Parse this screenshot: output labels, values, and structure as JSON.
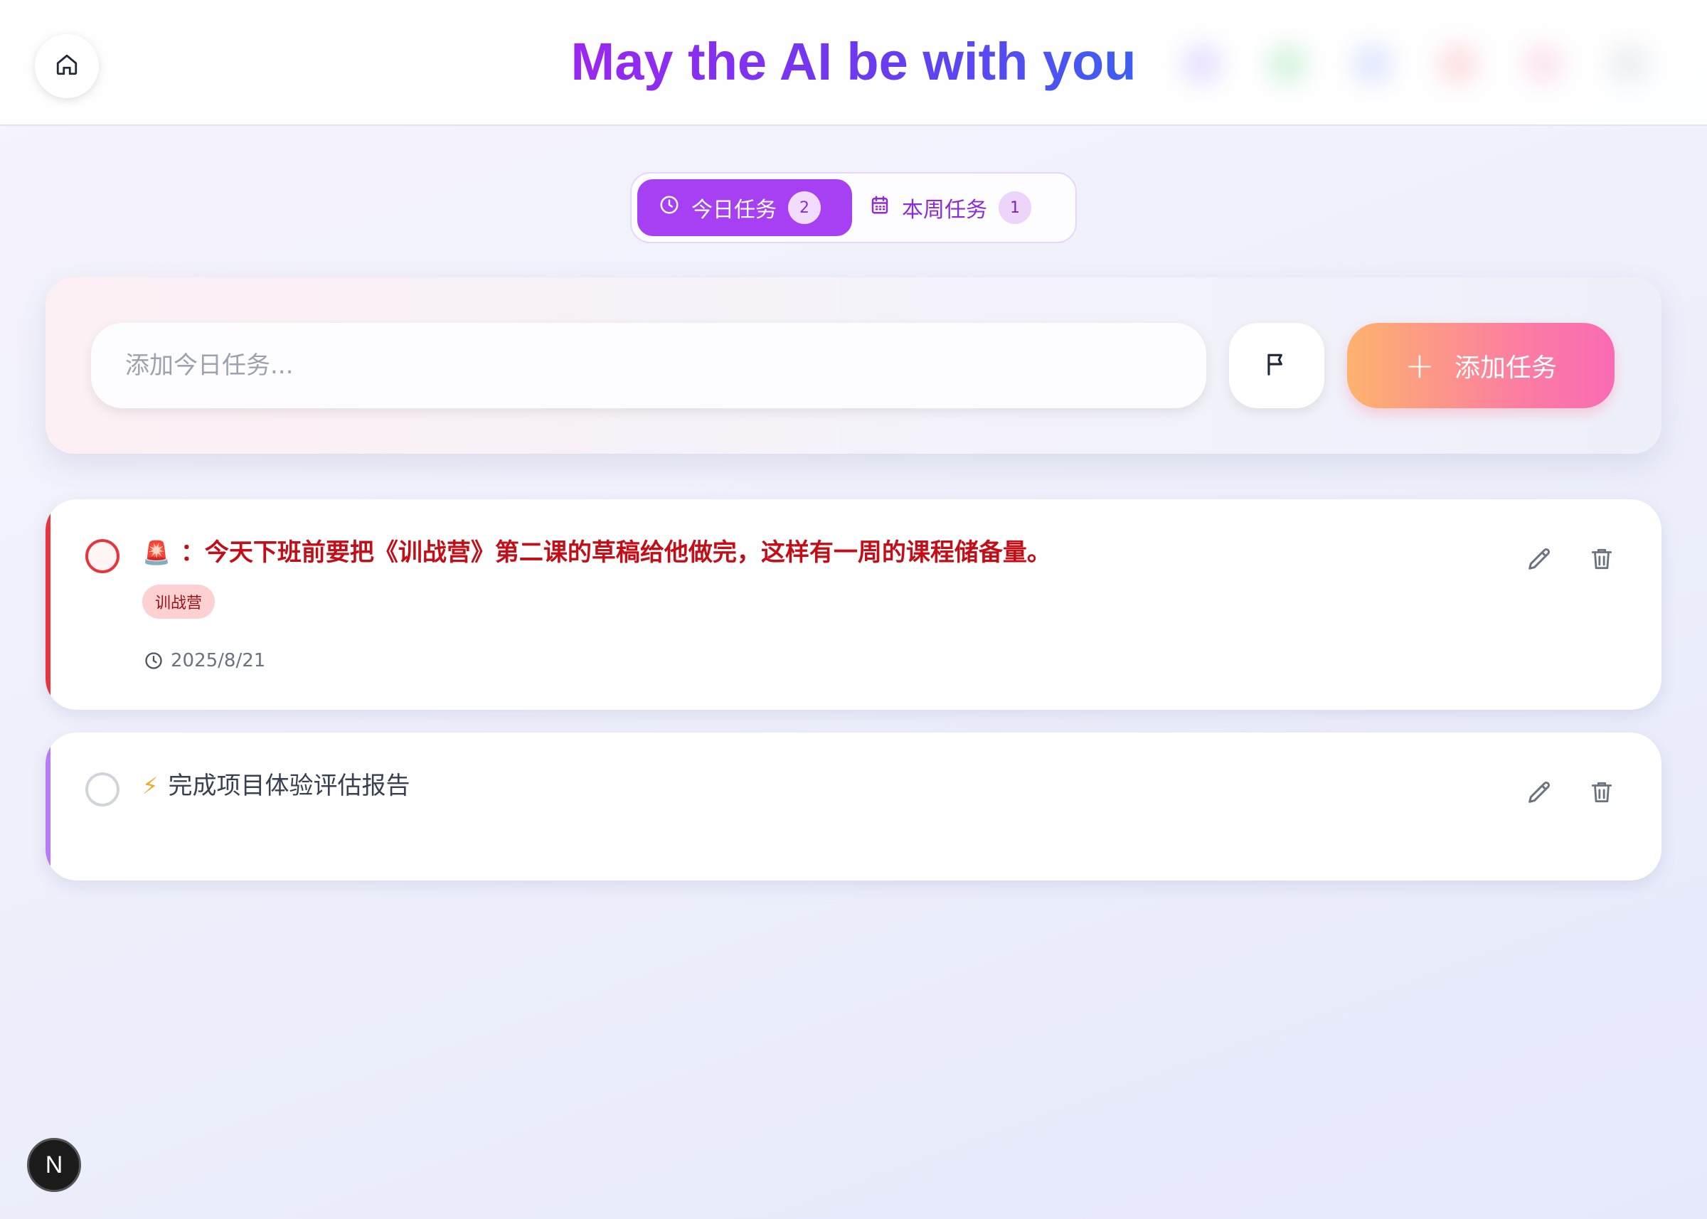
{
  "header": {
    "title": "May the AI be with you",
    "home_icon": "home-icon"
  },
  "tabs": [
    {
      "label": "今日任务",
      "count": "2",
      "icon": "clock-icon",
      "active": true
    },
    {
      "label": "本周任务",
      "count": "1",
      "icon": "calendar-icon",
      "active": false
    }
  ],
  "add_form": {
    "placeholder": "添加今日任务...",
    "value": "",
    "flag_icon": "flag-icon",
    "add_label": "添加任务"
  },
  "tasks": [
    {
      "emoji": "🚨",
      "text": "：今天下班前要把《训战营》第二课的草稿给他做完，这样有一周的课程储备量。",
      "tag": "训战营",
      "date": "2025/8/21",
      "priority_color": "#e7353d",
      "completed": false
    },
    {
      "emoji": "⚡",
      "text": "完成项目体验评估报告",
      "priority_color": "#b77cf5",
      "completed": false
    }
  ],
  "badge": {
    "label": "N"
  },
  "colors": {
    "accent_purple": "#a73ff3",
    "title_gradient_start": "#9b27f0",
    "title_gradient_end": "#3d5ff2",
    "add_button_start": "#fdb26e",
    "add_button_end": "#f96bb4",
    "urgent_red": "#c30d17"
  }
}
